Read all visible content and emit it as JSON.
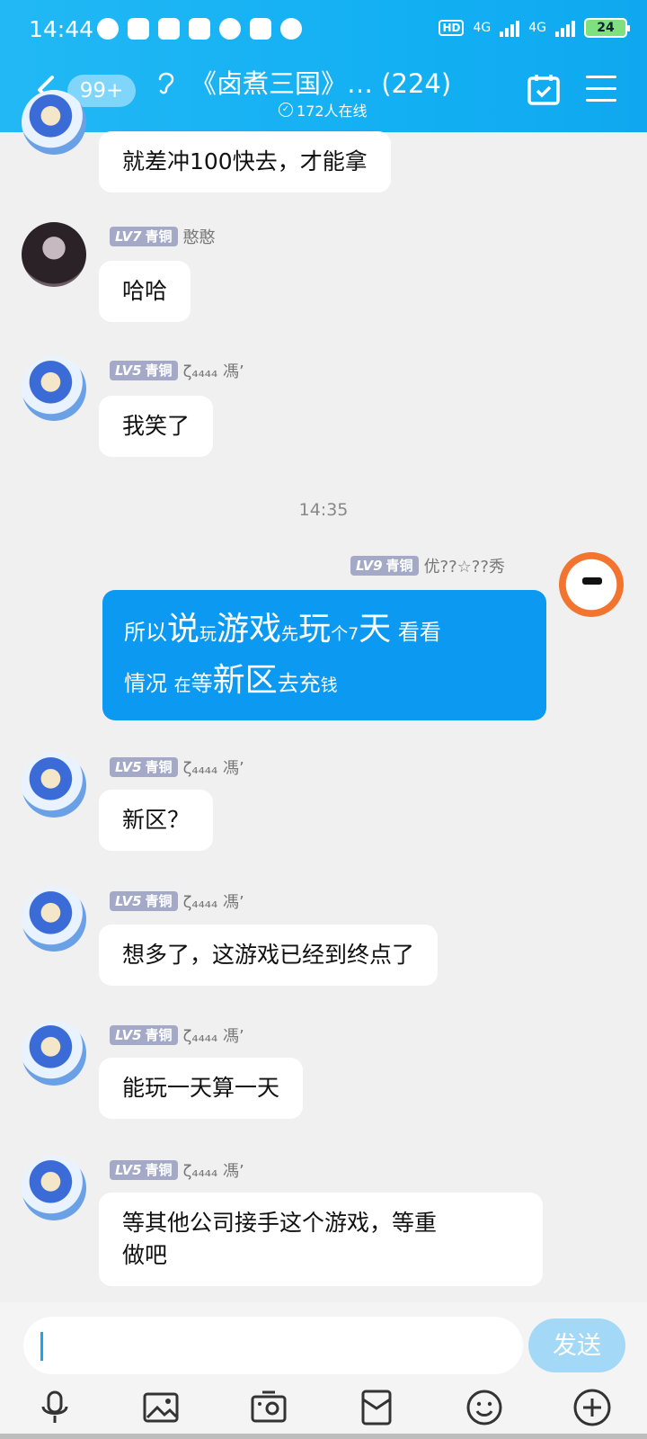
{
  "status": {
    "time": "14:44",
    "hd": "HD",
    "net1": "4G",
    "net2": "4G",
    "battery": "24"
  },
  "header": {
    "back_badge": "99+",
    "title": "《卤煮三国》… (224)",
    "online": "172人在线"
  },
  "messages": [
    {
      "text": "就差冲100快去，才能拿"
    },
    {
      "level": "LV7",
      "rank": "青铜",
      "name": "憨憨",
      "text": "哈哈"
    },
    {
      "level": "LV5",
      "rank": "青铜",
      "name": "ζ₄₄₄₄ 馮’",
      "text": "我笑了"
    },
    {
      "timestamp": "14:35"
    },
    {
      "level": "LV9",
      "rank": "青铜",
      "name": "优??☆??秀",
      "parts": [
        "所以",
        "说",
        "玩",
        "游戏",
        "先",
        "玩",
        "个7",
        "天",
        " 看看",
        "情况 ",
        "在",
        "等",
        "新区",
        "去充",
        "钱"
      ]
    },
    {
      "level": "LV5",
      "rank": "青铜",
      "name": "ζ₄₄₄₄ 馮’",
      "text": "新区？"
    },
    {
      "level": "LV5",
      "rank": "青铜",
      "name": "ζ₄₄₄₄ 馮’",
      "text": "想多了，这游戏已经到终点了"
    },
    {
      "level": "LV5",
      "rank": "青铜",
      "name": "ζ₄₄₄₄ 馮’",
      "text": "能玩一天算一天"
    },
    {
      "level": "LV5",
      "rank": "青铜",
      "name": "ζ₄₄₄₄ 馮’",
      "text1": "等其他公司接手这个游戏，等重",
      "text2": "做吧"
    }
  ],
  "input": {
    "placeholder": "",
    "send_label": "发送"
  },
  "toolbar": [
    "mic-icon",
    "image-icon",
    "camera-icon",
    "red-packet-icon",
    "emoji-icon",
    "plus-icon"
  ],
  "colors": {
    "header": "#13b0f3",
    "self_bubble": "#0b99f2",
    "send_button": "#a3d9f7",
    "level_badge": "#a3a9c7"
  }
}
